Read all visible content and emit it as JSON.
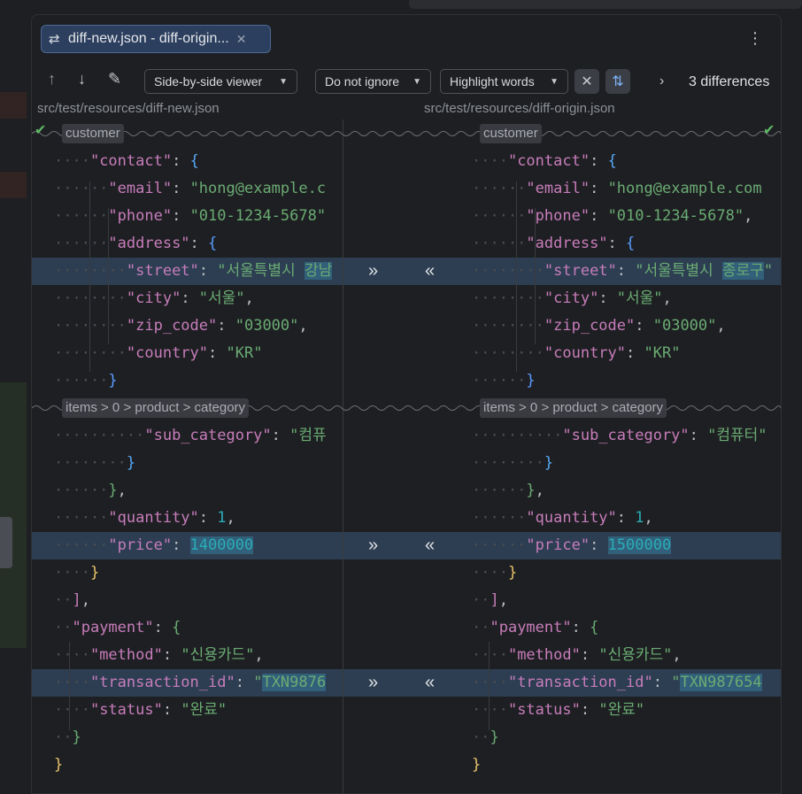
{
  "tab": {
    "title": "diff-new.json - diff-origin...",
    "icon": "diff-arrows-icon"
  },
  "toolbar": {
    "viewer": "Side-by-side viewer",
    "ignore": "Do not ignore",
    "highlight": "Highlight words",
    "differences": "3 differences"
  },
  "paths": {
    "left": "src/test/resources/diff-new.json",
    "right": "src/test/resources/diff-origin.json"
  },
  "folds": {
    "customer": "customer",
    "items": "items > 0 > product > category"
  },
  "left_lines": [
    {
      "dots": "····",
      "html": "<span class='k'>\"contact\"</span><span class='p'>: </span><span class='b3'>{</span>"
    },
    {
      "dots": "······",
      "html": "<span class='k'>\"email\"</span><span class='p'>: </span><span class='s'>\"hong@example.c</span>"
    },
    {
      "dots": "······",
      "html": "<span class='k'>\"phone\"</span><span class='p'>: </span><span class='s'>\"010-1234-5678\"</span>"
    },
    {
      "dots": "······",
      "html": "<span class='k'>\"address\"</span><span class='p'>: </span><span class='b5'>{</span>"
    },
    {
      "dots": "········",
      "html": "<span class='k'>\"street\"</span><span class='p'>: </span><span class='s'>\"서울특별시 <span class='hl'>강남</span></span>",
      "changed": true
    },
    {
      "dots": "········",
      "html": "<span class='k'>\"city\"</span><span class='p'>: </span><span class='s'>\"서울\"</span><span class='p'>,</span>"
    },
    {
      "dots": "········",
      "html": "<span class='k'>\"zip_code\"</span><span class='p'>: </span><span class='s'>\"03000\"</span><span class='p'>,</span>"
    },
    {
      "dots": "········",
      "html": "<span class='k'>\"country\"</span><span class='p'>: </span><span class='s'>\"KR\"</span>"
    },
    {
      "dots": "······",
      "html": "<span class='b5'>}</span>"
    }
  ],
  "left_lines2": [
    {
      "dots": "··········",
      "html": "<span class='k'>\"sub_category\"</span><span class='p'>: </span><span class='s'>\"컴퓨</span>"
    },
    {
      "dots": "········",
      "html": "<span class='b3'>}</span>"
    },
    {
      "dots": "······",
      "html": "<span class='b4'>}</span><span class='p'>,</span>"
    },
    {
      "dots": "······",
      "html": "<span class='k'>\"quantity\"</span><span class='p'>: </span><span class='n'>1</span><span class='p'>,</span>"
    },
    {
      "dots": "······",
      "html": "<span class='k'>\"price\"</span><span class='p'>: </span><span class='n hl'>1400000</span>",
      "changed": true
    },
    {
      "dots": "····",
      "html": "<span class='b1'>}</span>"
    },
    {
      "dots": "··",
      "html": "<span class='b2'>]</span><span class='p'>,</span>"
    },
    {
      "dots": "··",
      "html": "<span class='k'>\"payment\"</span><span class='p'>: </span><span class='b4'>{</span>"
    },
    {
      "dots": "····",
      "html": "<span class='k'>\"method\"</span><span class='p'>: </span><span class='s'>\"신용카드\"</span><span class='p'>,</span>"
    },
    {
      "dots": "····",
      "html": "<span class='k'>\"transaction_id\"</span><span class='p'>: </span><span class='s'>\"<span class='hl'>TXN9876</span></span>",
      "changed": true
    },
    {
      "dots": "····",
      "html": "<span class='k'>\"status\"</span><span class='p'>: </span><span class='s'>\"완료\"</span>"
    },
    {
      "dots": "··",
      "html": "<span class='b4'>}</span>"
    },
    {
      "dots": "",
      "html": "<span class='b1'>}</span>"
    }
  ],
  "right_lines": [
    {
      "dots": "····",
      "html": "<span class='k'>\"contact\"</span><span class='p'>: </span><span class='b3'>{</span>"
    },
    {
      "dots": "······",
      "html": "<span class='k'>\"email\"</span><span class='p'>: </span><span class='s'>\"hong@example.com</span>"
    },
    {
      "dots": "······",
      "html": "<span class='k'>\"phone\"</span><span class='p'>: </span><span class='s'>\"010-1234-5678\"</span><span class='p'>,</span>"
    },
    {
      "dots": "······",
      "html": "<span class='k'>\"address\"</span><span class='p'>: </span><span class='b5'>{</span>"
    },
    {
      "dots": "········",
      "html": "<span class='k'>\"street\"</span><span class='p'>: </span><span class='s'>\"서울특별시 <span class='hl'>종로구</span>\"</span>",
      "changed": true
    },
    {
      "dots": "········",
      "html": "<span class='k'>\"city\"</span><span class='p'>: </span><span class='s'>\"서울\"</span><span class='p'>,</span>"
    },
    {
      "dots": "········",
      "html": "<span class='k'>\"zip_code\"</span><span class='p'>: </span><span class='s'>\"03000\"</span><span class='p'>,</span>"
    },
    {
      "dots": "········",
      "html": "<span class='k'>\"country\"</span><span class='p'>: </span><span class='s'>\"KR\"</span>"
    },
    {
      "dots": "······",
      "html": "<span class='b5'>}</span>"
    }
  ],
  "right_lines2": [
    {
      "dots": "··········",
      "html": "<span class='k'>\"sub_category\"</span><span class='p'>: </span><span class='s'>\"컴퓨터\"</span>"
    },
    {
      "dots": "········",
      "html": "<span class='b3'>}</span>"
    },
    {
      "dots": "······",
      "html": "<span class='b4'>}</span><span class='p'>,</span>"
    },
    {
      "dots": "······",
      "html": "<span class='k'>\"quantity\"</span><span class='p'>: </span><span class='n'>1</span><span class='p'>,</span>"
    },
    {
      "dots": "······",
      "html": "<span class='k'>\"price\"</span><span class='p'>: </span><span class='n hl'>1500000</span>",
      "changed": true
    },
    {
      "dots": "····",
      "html": "<span class='b1'>}</span>"
    },
    {
      "dots": "··",
      "html": "<span class='b2'>]</span><span class='p'>,</span>"
    },
    {
      "dots": "··",
      "html": "<span class='k'>\"payment\"</span><span class='p'>: </span><span class='b4'>{</span>"
    },
    {
      "dots": "····",
      "html": "<span class='k'>\"method\"</span><span class='p'>: </span><span class='s'>\"신용카드\"</span><span class='p'>,</span>"
    },
    {
      "dots": "····",
      "html": "<span class='k'>\"transaction_id\"</span><span class='p'>: </span><span class='s'>\"<span class='hl'>TXN987654</span></span>",
      "changed": true
    },
    {
      "dots": "····",
      "html": "<span class='k'>\"status\"</span><span class='p'>: </span><span class='s'>\"완료\"</span>"
    },
    {
      "dots": "··",
      "html": "<span class='b4'>}</span>"
    },
    {
      "dots": "",
      "html": "<span class='b1'>}</span>"
    }
  ],
  "colors": {
    "changed_bg": "#2d3e52",
    "word_highlight": "#32607a",
    "accent": "#4a6896"
  }
}
